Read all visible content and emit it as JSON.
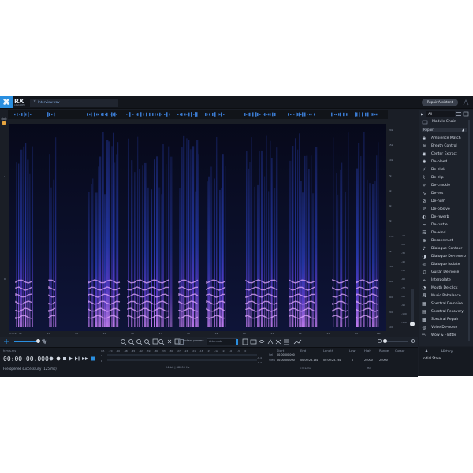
{
  "app": {
    "logo_text": "RX",
    "logo_sub": "ADVANCED",
    "file_tab": "Interview.wav",
    "file_tab_close": "✕",
    "repair_assistant": "Repair Assistant"
  },
  "frequency_scale": [
    "20k",
    "15k",
    "10k",
    "7k",
    "5k",
    "3k",
    "2k",
    "1.5k",
    "1k",
    "700",
    "500",
    "300",
    "200",
    "100"
  ],
  "db_scale": [
    "-10",
    "-20",
    "-30",
    "-40",
    "-50",
    "-60",
    "-70",
    "-80",
    "-90",
    "-100",
    "-110"
  ],
  "left_labels": [
    "L",
    "R"
  ],
  "time_ruler": [
    "h:m:s",
    "12",
    "13",
    "14",
    "15",
    "16",
    "17",
    "18",
    "19",
    "20",
    "21",
    "22",
    "23",
    "24"
  ],
  "time_ruler_end": "sec",
  "toolbar": {
    "instant_process": "Instant process",
    "attenuate": "Attenuate"
  },
  "transport": {
    "format": "h:m:s.ms",
    "timecode": "00:00:00.000",
    "status": "File opened successfully (125 ms)"
  },
  "meter": {
    "ticks": [
      "Inf.",
      "-70",
      "-60",
      "-48",
      "-45",
      "-42",
      "-39",
      "-36",
      "-33",
      "-30",
      "-27",
      "-24",
      "-21",
      "-18",
      "-15",
      "-12",
      "-9",
      "-6",
      "-3",
      "0"
    ],
    "channels": [
      "L",
      "R"
    ],
    "left_value": "-8.4",
    "right_value": "-8.4",
    "format": "24-bit | 48000 Hz"
  },
  "selection": {
    "headers": [
      "Start",
      "End",
      "Length",
      "Low",
      "High",
      "Range",
      "Cursor"
    ],
    "sel_label": "Sel",
    "view_label": "View",
    "sel_start": "00:00:00.000",
    "view_start": "00:00:00.000",
    "view_end": "00:00:25.161",
    "view_length": "00:00:25.161",
    "view_low": "0",
    "view_high": "24000",
    "view_range": "24000",
    "time_unit": "h:m:s.ms",
    "freq_unit": "Hz"
  },
  "module_panel": {
    "filter": "All",
    "module_chain": "Module Chain",
    "category": "Repair",
    "modules": [
      {
        "icon": "◈",
        "label": "Ambience Match"
      },
      {
        "icon": "≋",
        "label": "Breath Control"
      },
      {
        "icon": "◉",
        "label": "Center Extract"
      },
      {
        "icon": "✺",
        "label": "De-bleed"
      },
      {
        "icon": "⚡",
        "label": "De-click"
      },
      {
        "icon": "⌇",
        "label": "De-clip"
      },
      {
        "icon": "✧",
        "label": "De-crackle"
      },
      {
        "icon": "∿",
        "label": "De-ess"
      },
      {
        "icon": "⊘",
        "label": "De-hum"
      },
      {
        "icon": "ℙ",
        "label": "De-plosive"
      },
      {
        "icon": "◐",
        "label": "De-reverb"
      },
      {
        "icon": "≈",
        "label": "De-rustle"
      },
      {
        "icon": "☴",
        "label": "De-wind"
      },
      {
        "icon": "⊕",
        "label": "Deconstruct"
      },
      {
        "icon": "♪",
        "label": "Dialogue Contour"
      },
      {
        "icon": "◑",
        "label": "Dialogue De-reverb"
      },
      {
        "icon": "◎",
        "label": "Dialogue Isolate"
      },
      {
        "icon": "♫",
        "label": "Guitar De-noise"
      },
      {
        "icon": "⌁",
        "label": "Interpolate"
      },
      {
        "icon": "◔",
        "label": "Mouth De-click"
      },
      {
        "icon": "♬",
        "label": "Music Rebalance"
      },
      {
        "icon": "▦",
        "label": "Spectral De-noise"
      },
      {
        "icon": "▤",
        "label": "Spectral Recovery"
      },
      {
        "icon": "▩",
        "label": "Spectral Repair"
      },
      {
        "icon": "◍",
        "label": "Voice De-noise"
      },
      {
        "icon": "〰",
        "label": "Wow & Flutter"
      }
    ]
  },
  "history": {
    "tabs": "History",
    "initial_state": "Initial State"
  },
  "colors": {
    "accent": "#2a8fe0",
    "background": "#1a1e26",
    "spectrogram_low": "#1a2a8a",
    "spectrogram_high": "#d08cf0"
  }
}
